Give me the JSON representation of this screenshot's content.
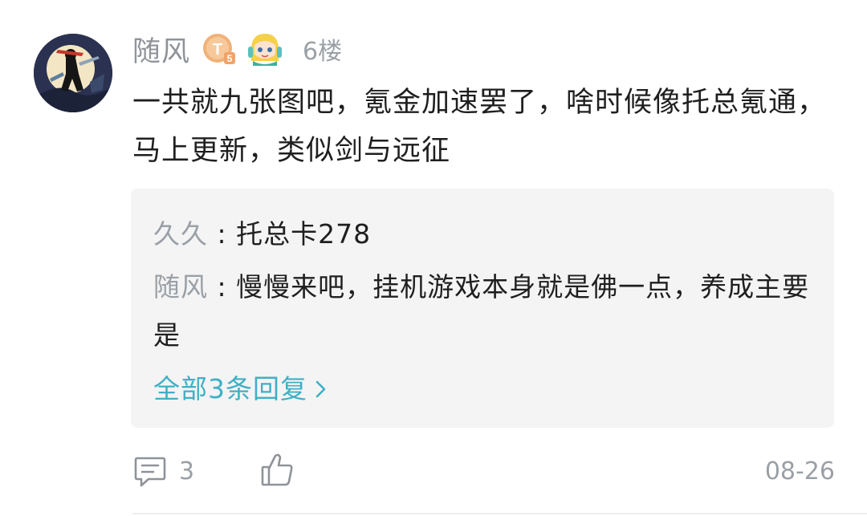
{
  "comment": {
    "username": "随风",
    "level_badge_letter": "T",
    "level_badge_number": "5",
    "floor": "6楼",
    "text": "一共就九张图吧，氪金加速罢了，啥时候像托总氪通，马上更新，类似剑与远征",
    "avatar_icon": "avatar-ninja-moon-icon",
    "fan_badge_icon": "anime-girl-badge-icon"
  },
  "replies": [
    {
      "name": "久久",
      "separator": " : ",
      "text": "托总卡278"
    },
    {
      "name": "随风",
      "separator": " : ",
      "text": "慢慢来吧，挂机游戏本身就是佛一点，养成主要是"
    }
  ],
  "more_replies_label": "全部3条回复",
  "footer": {
    "comment_count": "3",
    "date": "08-26"
  },
  "colors": {
    "link": "#3fb0c6",
    "muted": "#9aa0a6",
    "reply_bg": "#f4f4f4",
    "badge": "#f0b27a"
  }
}
